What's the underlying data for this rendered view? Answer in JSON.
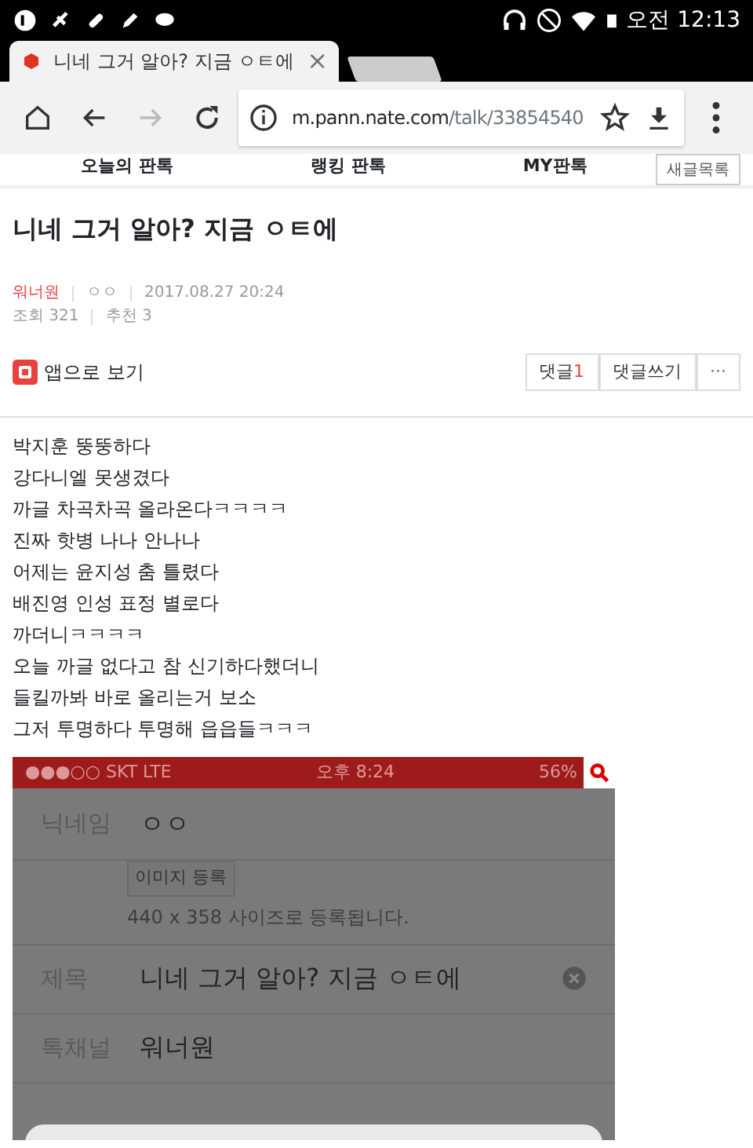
{
  "status_bar": {
    "time": "오전 12:13"
  },
  "browser_tabs": [
    {
      "title": "니네 그거 알아? 지금 ㅇㅌ에",
      "selected": true,
      "close": "×"
    },
    {
      "selected": false
    }
  ],
  "address_bar": {
    "host": "m.pann.nate.com",
    "path": "/talk/33854540"
  },
  "site_nav": [
    {
      "label": "오늘의 판톡"
    },
    {
      "label": "랭킹 판톡"
    },
    {
      "label": "MY판톡"
    }
  ],
  "new_posts_button": "새글목록",
  "post": {
    "title": "니네 그거 알아? 지금 ㅇㅌ에",
    "channel": "워너원",
    "author": "ㅇㅇ",
    "date": "2017.08.27 20:24",
    "views": "조회 321",
    "recommends": "추천 3",
    "app_link": "앱으로 보기",
    "comments_label": "댓글",
    "comments_count": "1",
    "write_comment": "댓글쓰기",
    "more": "···",
    "lines": [
      {
        "text": "박지훈 뚱뚱하다"
      },
      {
        "text": "강다니엘 못생겼다"
      },
      {
        "text": "까글 차곡차곡 올라온다ㅋㅋㅋㅋ"
      },
      {
        "text": "진짜 핫병 나나 안나나"
      },
      {
        "text": "어제는 윤지성 춤 틀렸다"
      },
      {
        "text": "배진영 인성 표정 별로다"
      },
      {
        "text": "까더니ㅋㅋㅋㅋ"
      },
      {
        "text": "오늘 까글 없다고 참 신기하다했더니"
      },
      {
        "text": "들킬까봐 바로 올리는거 보소"
      },
      {
        "text": "그저 투명하다 투명해 읍읍들ㅋㅋㅋ"
      }
    ]
  },
  "embedded_screenshot": {
    "carrier": "●●●○○ SKT  LTE",
    "time": "오후 8:24",
    "battery": "56%",
    "fields": [
      {
        "kind": "text",
        "label": "닉네임",
        "value": "ㅇㅇ"
      },
      {
        "kind": "image",
        "button": "이미지 등록",
        "hint": "440 x 358 사이즈로 등록됩니다."
      },
      {
        "kind": "text",
        "label": "제목",
        "value": "니네 그거 알아? 지금 ㅇㅌ에",
        "clearable": true
      },
      {
        "kind": "text",
        "label": "톡채널",
        "value": "워너원"
      }
    ]
  }
}
